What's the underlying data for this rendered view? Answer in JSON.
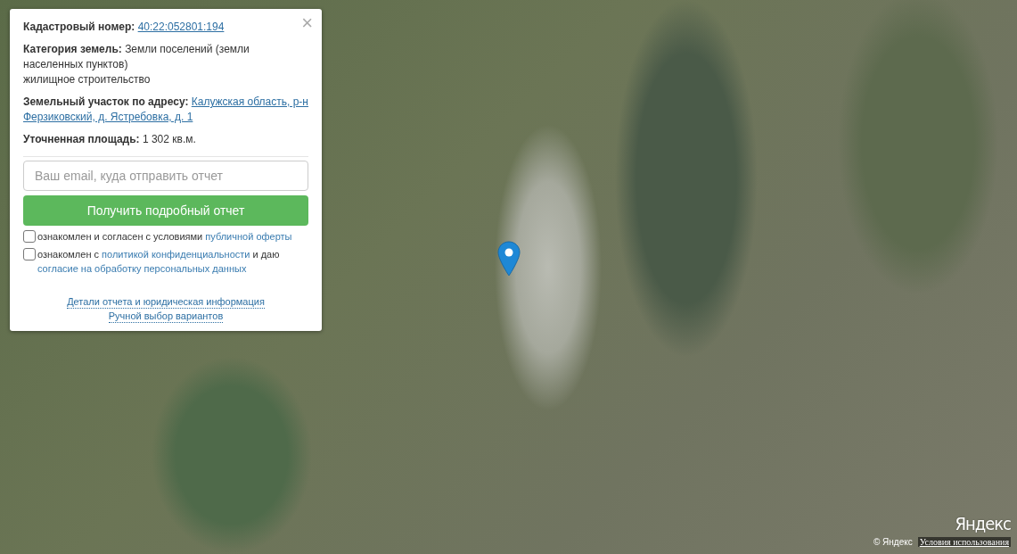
{
  "info_card": {
    "close": "×",
    "fields": [
      {
        "kind": "link",
        "label": "Кадастровый номер:",
        "value_lines": [
          "40:22:052801:194"
        ]
      },
      {
        "kind": "text",
        "label": "Категория земель:",
        "value_lines": [
          "Земли поселений (земли",
          "населенных пунктов)",
          "жилищное строительство"
        ]
      },
      {
        "kind": "link",
        "label": "Земельный участок по адресу:",
        "value_lines": [
          "Калужская область, р-н",
          "Ферзиковский, д. Ястребовка, д. 1"
        ]
      },
      {
        "kind": "text",
        "label": "Уточненная площадь:",
        "value_lines": [
          "1 302 кв.м."
        ]
      }
    ],
    "email": {
      "placeholder": "Ваш email, куда отправить отчет"
    },
    "submit": "Получить подробный отчет",
    "consents": [
      {
        "checked": false,
        "parts": [
          {
            "text": "ознакомлен и согласен с условиями ",
            "link": false
          },
          {
            "text": "публичной оферты",
            "link": true
          }
        ]
      },
      {
        "checked": false,
        "parts": [
          {
            "text": "ознакомлен с ",
            "link": false
          },
          {
            "text": "политикой конфиденциальности",
            "link": true
          },
          {
            "text": " и даю ",
            "link": false
          },
          {
            "text": "согласие на обработку персональных данных",
            "link": true
          }
        ]
      }
    ],
    "footer_links": [
      "Детали отчета и юридическая информация",
      "Ручной выбор вариантов"
    ]
  },
  "map": {
    "logo": "Яндекс",
    "copyright": "© Яндекс",
    "terms": "Условия использования"
  }
}
